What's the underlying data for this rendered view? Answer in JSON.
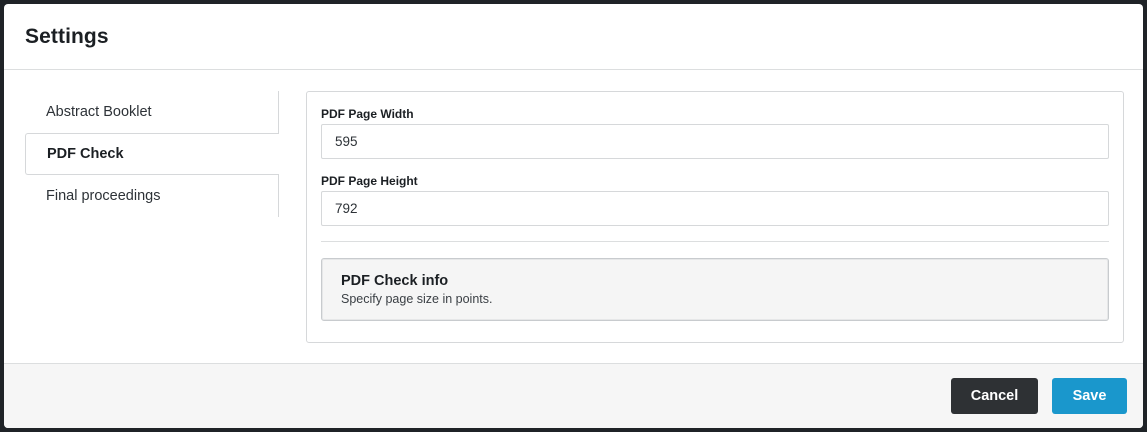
{
  "modal": {
    "title": "Settings"
  },
  "sidebar": {
    "items": [
      {
        "label": "Abstract Booklet",
        "active": false
      },
      {
        "label": "PDF Check",
        "active": true
      },
      {
        "label": "Final proceedings",
        "active": false
      }
    ]
  },
  "form": {
    "width": {
      "label": "PDF Page Width",
      "value": "595"
    },
    "height": {
      "label": "PDF Page Height",
      "value": "792"
    }
  },
  "info": {
    "title": "PDF Check info",
    "text": "Specify page size in points."
  },
  "footer": {
    "cancel_label": "Cancel",
    "save_label": "Save"
  },
  "colors": {
    "overlay": "#1f2327",
    "save_button": "#1a97cc",
    "cancel_button": "#2e3134"
  }
}
